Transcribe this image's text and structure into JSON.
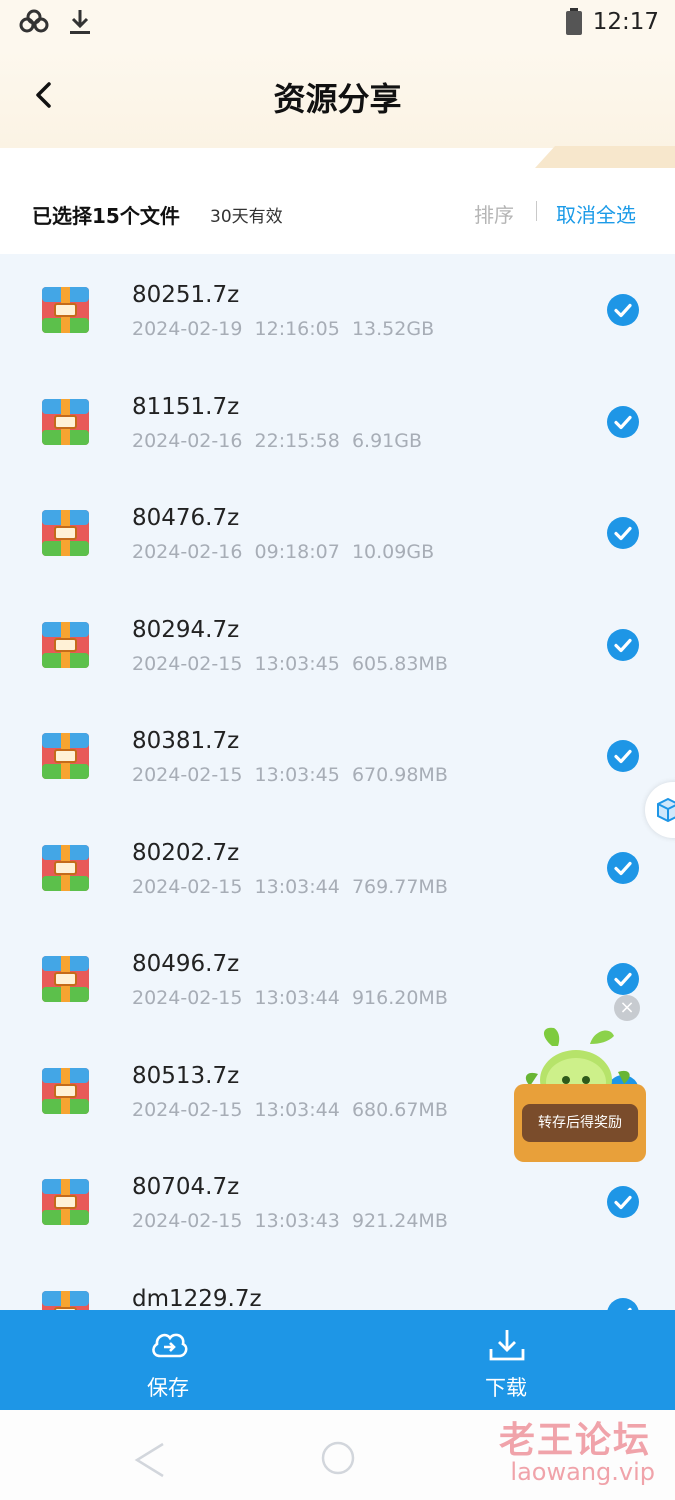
{
  "status_bar": {
    "time": "12:17"
  },
  "header": {
    "title": "资源分享"
  },
  "selection_bar": {
    "selected_text": "已选择15个文件",
    "validity": "30天有效",
    "sort_label": "排序",
    "cancel_select_all_label": "取消全选"
  },
  "files": [
    {
      "name": "80251.7z",
      "date": "2024-02-19",
      "time": "12:16:05",
      "size": "13.52GB"
    },
    {
      "name": "81151.7z",
      "date": "2024-02-16",
      "time": "22:15:58",
      "size": "6.91GB"
    },
    {
      "name": "80476.7z",
      "date": "2024-02-16",
      "time": "09:18:07",
      "size": "10.09GB"
    },
    {
      "name": "80294.7z",
      "date": "2024-02-15",
      "time": "13:03:45",
      "size": "605.83MB"
    },
    {
      "name": "80381.7z",
      "date": "2024-02-15",
      "time": "13:03:45",
      "size": "670.98MB"
    },
    {
      "name": "80202.7z",
      "date": "2024-02-15",
      "time": "13:03:44",
      "size": "769.77MB"
    },
    {
      "name": "80496.7z",
      "date": "2024-02-15",
      "time": "13:03:44",
      "size": "916.20MB"
    },
    {
      "name": "80513.7z",
      "date": "2024-02-15",
      "time": "13:03:44",
      "size": "680.67MB"
    },
    {
      "name": "80704.7z",
      "date": "2024-02-15",
      "time": "13:03:43",
      "size": "921.24MB"
    },
    {
      "name": "dm1229.7z",
      "date": "",
      "time": "",
      "size": ""
    }
  ],
  "promo": {
    "label": "转存后得奖励"
  },
  "bottom_bar": {
    "save_label": "保存",
    "download_label": "下载"
  },
  "watermark": {
    "text": "老王论坛",
    "url": "laowang.vip"
  },
  "colors": {
    "accent": "#1e96e6",
    "list_bg": "#f0f6fc",
    "meta_text": "#a7adb6"
  }
}
